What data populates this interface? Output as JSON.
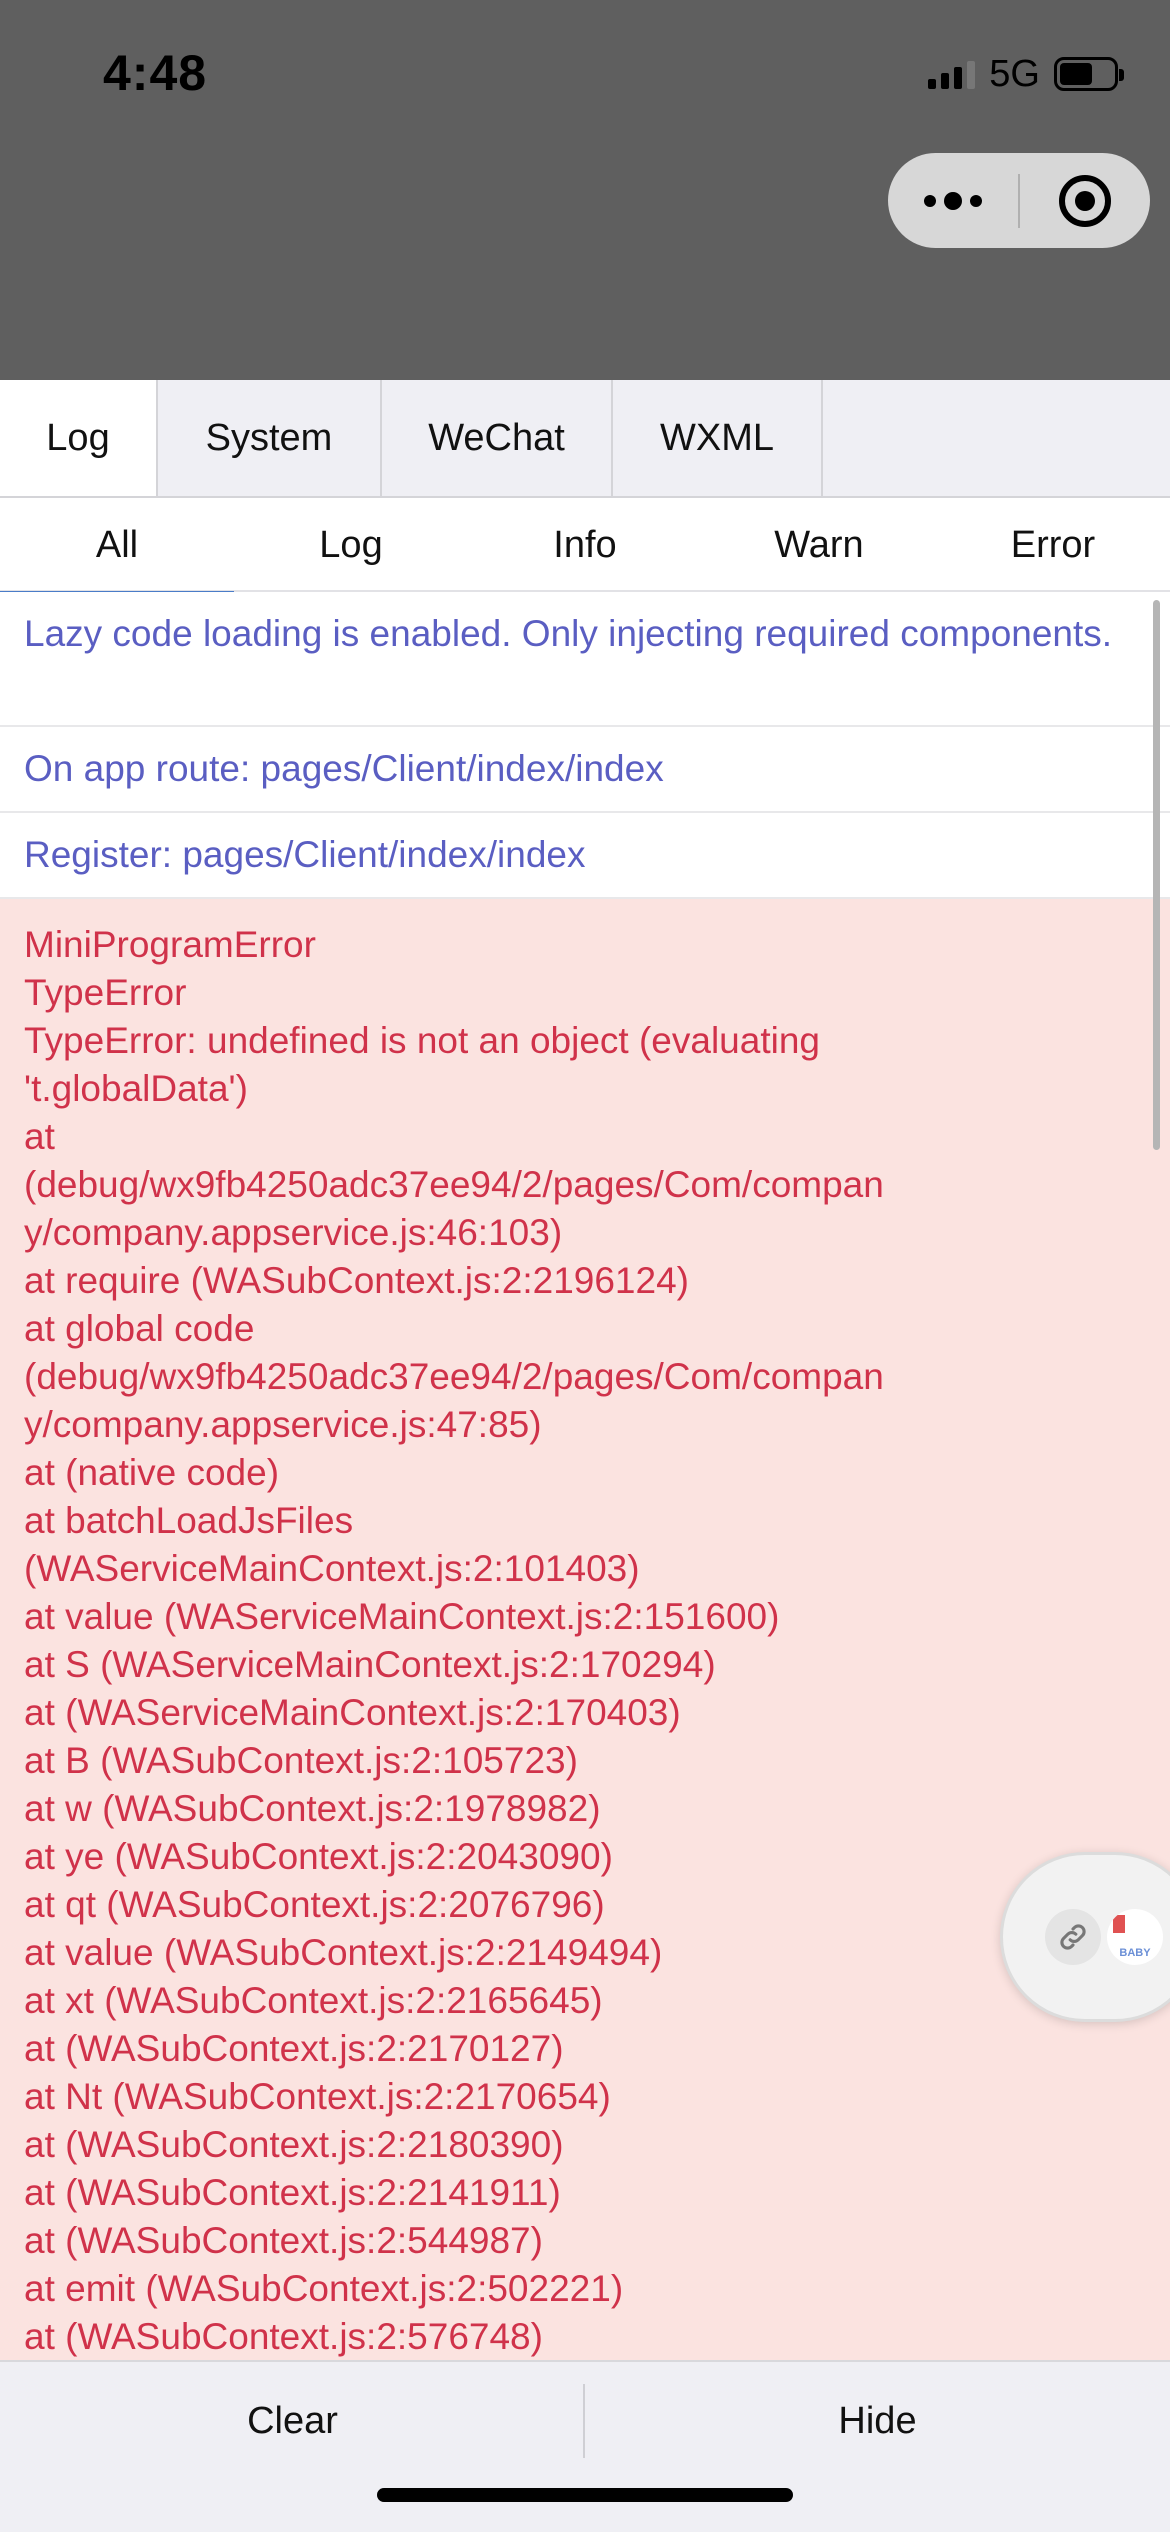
{
  "status_bar": {
    "time": "4:48",
    "network": "5G",
    "battery_level": 0.62
  },
  "main_tabs": [
    {
      "label": "Log"
    },
    {
      "label": "System"
    },
    {
      "label": "WeChat"
    },
    {
      "label": "WXML"
    }
  ],
  "sub_tabs": [
    {
      "label": "All"
    },
    {
      "label": "Log"
    },
    {
      "label": "Info"
    },
    {
      "label": "Warn"
    },
    {
      "label": "Error"
    }
  ],
  "logs": [
    {
      "text": "Lazy code loading is enabled. Only injecting required components."
    },
    {
      "text": "On app route: pages/Client/index/index"
    },
    {
      "text": "Register: pages/Client/index/index"
    }
  ],
  "error_lines": [
    "MiniProgramError",
    "TypeError",
    "TypeError: undefined is not an object (evaluating",
    "'t.globalData')",
    "at",
    "(debug/wx9fb4250adc37ee94/2/pages/Com/compan",
    "y/company.appservice.js:46:103)",
    "at require (WASubContext.js:2:2196124)",
    "at global code",
    "(debug/wx9fb4250adc37ee94/2/pages/Com/compan",
    "y/company.appservice.js:47:85)",
    "at (native code)",
    "at batchLoadJsFiles",
    "(WAServiceMainContext.js:2:101403)",
    "at value (WAServiceMainContext.js:2:151600)",
    "at S (WAServiceMainContext.js:2:170294)",
    "at (WAServiceMainContext.js:2:170403)",
    "at B (WASubContext.js:2:105723)",
    "at w (WASubContext.js:2:1978982)",
    "at ye (WASubContext.js:2:2043090)",
    "at qt (WASubContext.js:2:2076796)",
    "at value (WASubContext.js:2:2149494)",
    "at xt (WASubContext.js:2:2165645)",
    "at (WASubContext.js:2:2170127)",
    "at Nt (WASubContext.js:2:2170654)",
    "at (WASubContext.js:2:2180390)",
    "at (WASubContext.js:2:2141911)",
    "at (WASubContext.js:2:544987)",
    "at emit (WASubContext.js:2:502221)",
    "at (WASubContext.js:2:576748)"
  ],
  "bottom": {
    "clear_label": "Clear",
    "hide_label": "Hide"
  },
  "floating_badge": {
    "logo_text": "BABY"
  },
  "colors": {
    "info_text": "#5a5ec2",
    "error_text": "#d0324a",
    "error_bg": "#fbe3e0",
    "active_tab_underline": "#4a7cc8"
  }
}
